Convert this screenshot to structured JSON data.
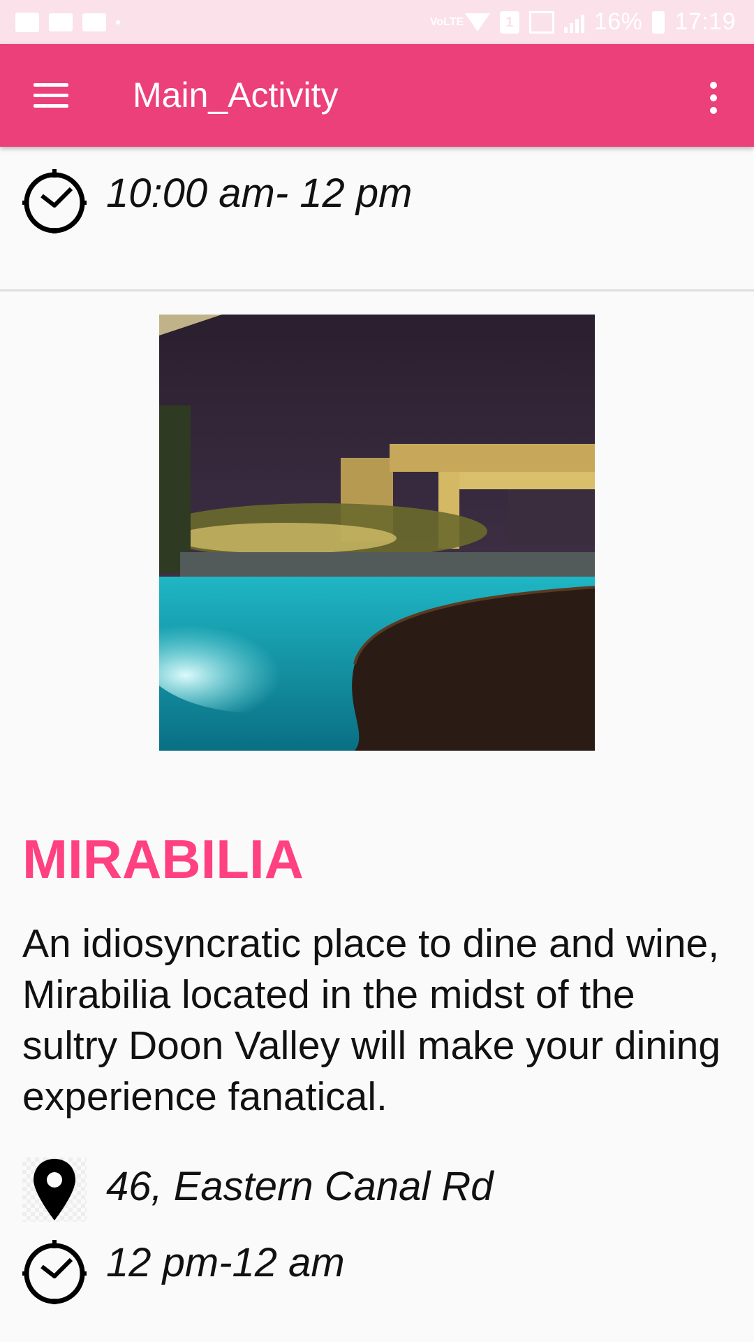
{
  "status_bar": {
    "battery": "16%",
    "time": "17:19",
    "network": "VoLTE",
    "sim": "1",
    "icons": [
      "photo-icon",
      "mail-icon",
      "activity-icon",
      "dot-icon",
      "volte-icon",
      "wifi-icon",
      "sim-icon",
      "signal-icon",
      "battery-icon"
    ]
  },
  "app_bar": {
    "title": "Main_Activity",
    "menu_icon": "hamburger-menu-icon",
    "overflow_icon": "more-vert-icon"
  },
  "previous_item": {
    "hours": "10:00 am- 12 pm",
    "icon": "clock-icon"
  },
  "place": {
    "name": "MIRABILIA",
    "description": "An idiosyncratic place to dine and wine, Mirabilia located in the midst of the sultry Doon Valley will make your dining experience fanatical.",
    "address": "46, Eastern Canal Rd",
    "hours": "12 pm-12 am",
    "address_icon": "location-pin-icon",
    "hours_icon": "clock-icon",
    "image": "pool-night-photo"
  },
  "colors": {
    "status_bar": "#fbe1ea",
    "app_bar": "#ec407a",
    "name_accent": "#ff4081",
    "background": "#fafafa"
  }
}
